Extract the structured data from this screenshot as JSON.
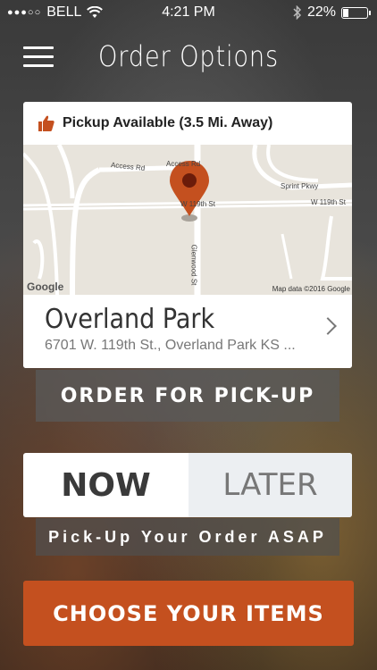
{
  "status_bar": {
    "signal_dots": "●●●○○",
    "carrier": "BELL",
    "time": "4:21 PM",
    "battery_percent": "22%",
    "battery_level": 0.22
  },
  "header": {
    "title": "Order Options",
    "menu_icon": "hamburger-icon"
  },
  "pickup_card": {
    "availability": "Pickup Available (3.5 Mi. Away)",
    "availability_icon": "thumbs-up-icon",
    "map": {
      "labels": {
        "access_rd_1": "Access Rd",
        "access_rd_2": "Access Rd",
        "sprint_pkwy": "Sprint Pkwy",
        "w119_left": "W 119th St",
        "w119_right": "W 119th St",
        "glenwood": "Glenwood St",
        "google": "Google",
        "copyright": "Map data ©2016 Google"
      },
      "pin_color": "#c4501f"
    },
    "location_name": "Overland Park",
    "location_address": "6701 W. 119th St., Overland Park KS ..."
  },
  "order_button": {
    "label": "ORDER FOR PICK-UP"
  },
  "time_toggle": {
    "now_label": "NOW",
    "later_label": "LATER",
    "selected": "NOW"
  },
  "asap_text": "Pick-Up Your Order ASAP",
  "choose_button": {
    "label": "CHOOSE YOUR ITEMS"
  },
  "colors": {
    "accent": "#c4501f",
    "now_text": "#3a3a3a",
    "later_bg": "#eceff2"
  }
}
